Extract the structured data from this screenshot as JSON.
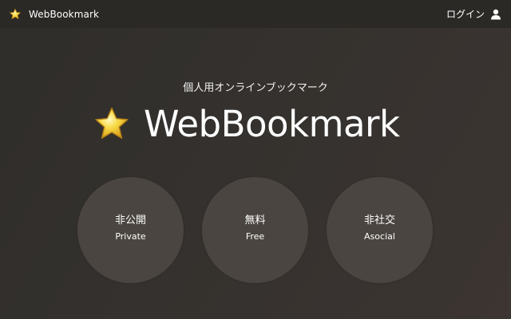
{
  "app": {
    "brand_name": "WebBookmark",
    "login_label": "ログイン"
  },
  "hero": {
    "tagline": "個人用オンラインブックマーク",
    "title": "WebBookmark"
  },
  "features": [
    {
      "title": "非公開",
      "subtitle": "Private"
    },
    {
      "title": "無料",
      "subtitle": "Free"
    },
    {
      "title": "非社交",
      "subtitle": "Asocial"
    }
  ],
  "icons": {
    "brand": "star-icon",
    "login": "user-icon",
    "hero": "star-icon"
  },
  "colors": {
    "star_fill": "#f6d53b",
    "star_stroke": "#c8961e",
    "topbar_bg": "#2a2926",
    "circle_bg": "#4a4540"
  }
}
